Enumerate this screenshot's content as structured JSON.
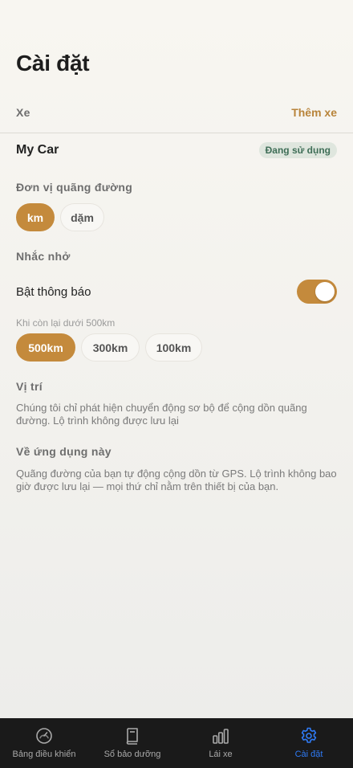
{
  "header": {
    "title": "Cài đặt"
  },
  "vehicle": {
    "section_label": "Xe",
    "add_label": "Thêm xe",
    "car_name": "My Car",
    "status_badge": "Đang sử dụng"
  },
  "distance_unit": {
    "label": "Đơn vị quãng đường",
    "options": [
      "km",
      "dặm"
    ],
    "selected": "km"
  },
  "reminders": {
    "label": "Nhắc nhở",
    "notify_label": "Bật thông báo",
    "notify_enabled": true,
    "threshold_hint": "Khi còn lại dưới 500km",
    "threshold_options": [
      "500km",
      "300km",
      "100km"
    ],
    "selected": "500km"
  },
  "location": {
    "label": "Vị trí",
    "text": "Chúng tôi chỉ phát hiện chuyển động sơ bộ để cộng dồn quãng đường. Lộ trình không được lưu lại"
  },
  "about": {
    "label": "Về ứng dụng này",
    "text": "Quãng đường của bạn tự động cộng dồn từ GPS. Lộ trình không bao giờ được lưu lại — mọi thứ chỉ nằm trên thiết bị của bạn."
  },
  "tabbar": {
    "items": [
      {
        "label": "Bảng điều khiển",
        "icon": "gauge-icon"
      },
      {
        "label": "Sổ bảo dưỡng",
        "icon": "book-icon"
      },
      {
        "label": "Lái xe",
        "icon": "bar-chart-icon"
      },
      {
        "label": "Cài đặt",
        "icon": "gear-icon"
      }
    ],
    "active_index": 3
  },
  "colors": {
    "accent": "#c48a3c",
    "link": "#b8843a",
    "tab_active": "#2f7bf6",
    "badge_text": "#3f6e57"
  }
}
